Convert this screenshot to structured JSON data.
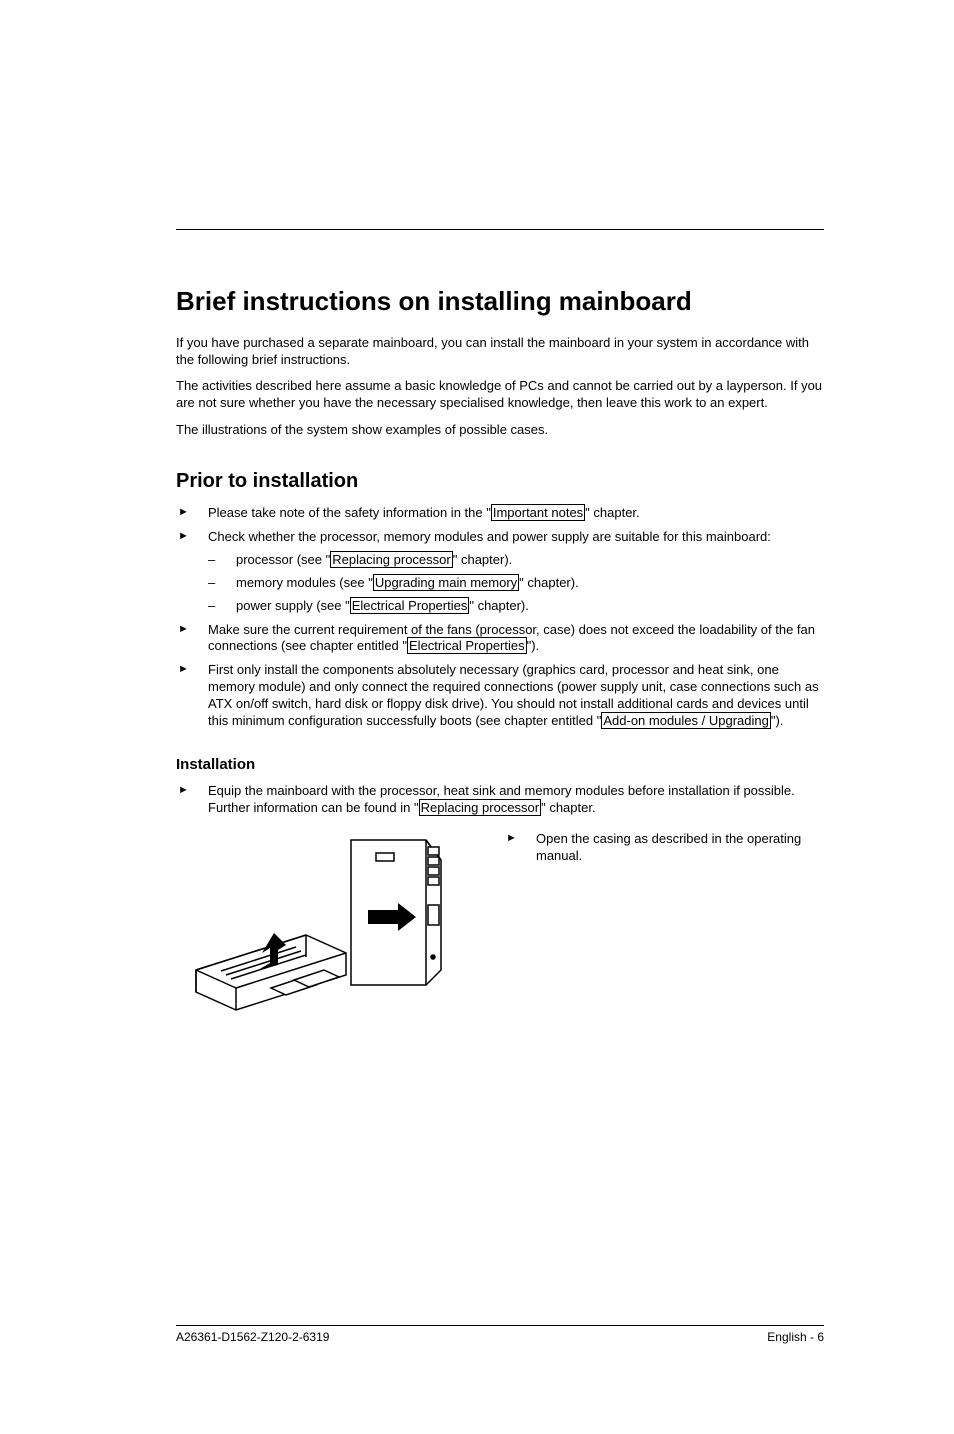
{
  "h1": "Brief instructions on installing mainboard",
  "intro": [
    "If you have purchased a separate mainboard, you can install the mainboard in your system in accordance with the following brief instructions.",
    "The activities described here assume a basic knowledge of PCs and cannot be carried out by a layperson. If you are not sure whether you have the necessary specialised knowledge, then leave this work to an expert.",
    "The illustrations of the system show examples of possible cases."
  ],
  "h2": "Prior to installation",
  "b1a": "Please take note of the safety information in the \"",
  "b1link": "Important notes",
  "b1b": "\" chapter.",
  "b2": "Check whether the processor, memory modules and power supply are suitable for this mainboard:",
  "d1a": "processor (see \"",
  "d1link": "Replacing processor",
  "d1b": "\" chapter).",
  "d2a": "memory modules (see \"",
  "d2link": "Upgrading main memory",
  "d2b": "\" chapter).",
  "d3a": "power supply (see \"",
  "d3link": "Electrical Properties",
  "d3b": "\" chapter).",
  "b3a": "Make sure the current requirement of the fans (processor, case) does not exceed the loadability of the fan connections (see chapter entitled \"",
  "b3link": "Electrical Properties",
  "b3b": "\").",
  "b4a": "First only install the components absolutely necessary (graphics card, processor and heat sink, one memory module) and only connect the required connections (power supply unit, case connections such as ATX on/off switch, hard disk or floppy disk drive). You should not install additional cards and devices until this minimum configuration successfully boots (see chapter entitled \"",
  "b4link": "Add-on modules / Upgrading",
  "b4b": "\").",
  "h3": "Installation",
  "b5a": "Equip the mainboard with the processor, heat sink and memory modules before installation if possible. Further information can be found in \"",
  "b5link": "Replacing processor",
  "b5b": "\" chapter.",
  "b6": "Open the casing as described in the operating manual.",
  "footerLeft": "A26361-D1562-Z120-2-6319",
  "footerRight": "English - 6"
}
